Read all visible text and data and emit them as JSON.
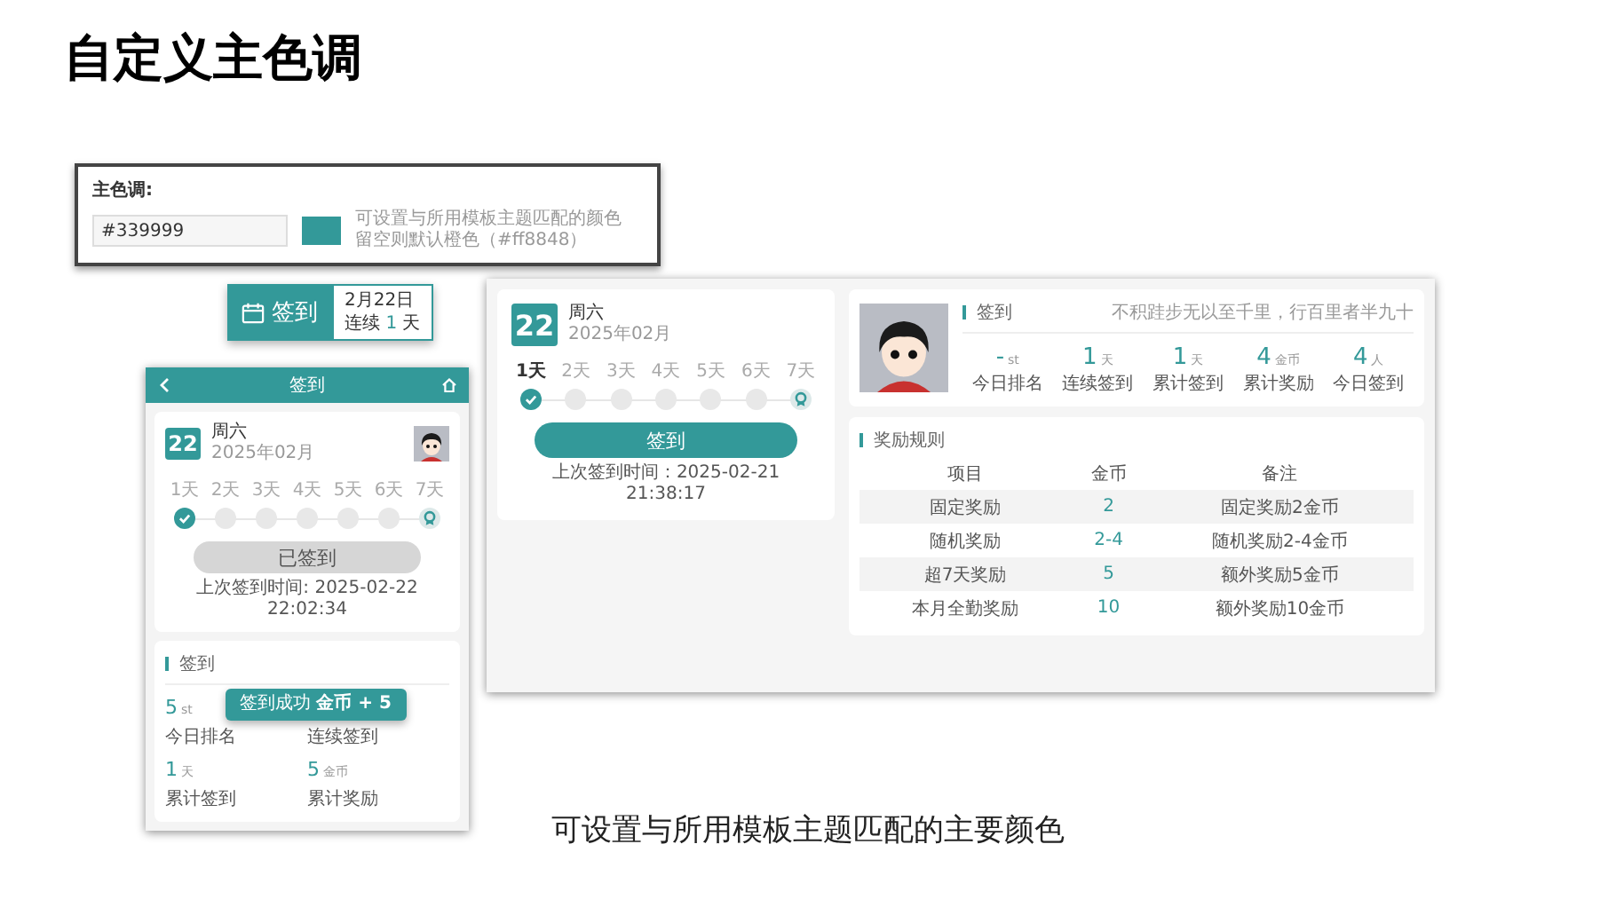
{
  "title": "自定义主色调",
  "color_setting": {
    "label": "主色调:",
    "value": "#339999",
    "hint_lines": [
      "可设置与所用模板主题匹配的颜色",
      "留空则默认橙色（#ff8848）"
    ]
  },
  "sign_button": {
    "label": "签到",
    "date": "2月22日",
    "streak_prefix": "连续",
    "streak_count": "1",
    "streak_suffix": "天"
  },
  "mobile": {
    "header_title": "签到",
    "day": "22",
    "weekday": "周六",
    "month": "2025年02月",
    "days": [
      {
        "label": "1天",
        "kind": "day",
        "signed": true,
        "current": false
      },
      {
        "label": "2天",
        "kind": "day",
        "signed": false,
        "current": false
      },
      {
        "label": "3天",
        "kind": "day",
        "signed": false,
        "current": false
      },
      {
        "label": "4天",
        "kind": "day",
        "signed": false,
        "current": false
      },
      {
        "label": "5天",
        "kind": "day",
        "signed": false,
        "current": false
      },
      {
        "label": "6天",
        "kind": "day",
        "signed": false,
        "current": false
      },
      {
        "label": "7天",
        "kind": "reward",
        "signed": false,
        "current": false
      }
    ],
    "button": {
      "label": "已签到",
      "disabled": true
    },
    "last_sign": "上次签到时间:  2025-02-22 22:02:34",
    "section_title": "签到",
    "toast": "签到成功 **金币 + 5**",
    "stats": [
      {
        "value": "5",
        "unit": "st",
        "label": "今日排名"
      },
      {
        "label": "连续签到"
      },
      {
        "value": "1",
        "unit": "天",
        "label": "累计签到"
      },
      {
        "value": "5",
        "unit": "金币",
        "label": "累计奖励"
      }
    ]
  },
  "desktop": {
    "day": "22",
    "weekday": "周六",
    "month": "2025年02月",
    "days": [
      {
        "label": "1天",
        "kind": "day",
        "signed": true,
        "current": true
      },
      {
        "label": "2天",
        "kind": "day",
        "signed": false,
        "current": false
      },
      {
        "label": "3天",
        "kind": "day",
        "signed": false,
        "current": false
      },
      {
        "label": "4天",
        "kind": "day",
        "signed": false,
        "current": false
      },
      {
        "label": "5天",
        "kind": "day",
        "signed": false,
        "current": false
      },
      {
        "label": "6天",
        "kind": "day",
        "signed": false,
        "current": false
      },
      {
        "label": "7天",
        "kind": "reward",
        "signed": false,
        "current": false
      }
    ],
    "button": {
      "label": "签到",
      "disabled": false
    },
    "last_sign": "上次签到时间：2025-02-21 21:38:17",
    "profile": {
      "section_title": "签到",
      "motto": "不积跬步无以至千里，行百里者半九十",
      "stats": [
        {
          "value": "-",
          "unit": "st",
          "label": "今日排名"
        },
        {
          "value": "1",
          "unit": "天",
          "label": "连续签到"
        },
        {
          "value": "1",
          "unit": "天",
          "label": "累计签到"
        },
        {
          "value": "4",
          "unit": "金币",
          "label": "累计奖励"
        },
        {
          "value": "4",
          "unit": "人",
          "label": "今日签到"
        }
      ]
    },
    "rewards": {
      "title": "奖励规则",
      "columns": [
        "项目",
        "金币",
        "备注"
      ],
      "rows": [
        [
          "固定奖励",
          "2",
          "固定奖励2金币"
        ],
        [
          "随机奖励",
          "2-4",
          "随机奖励2-4金币"
        ],
        [
          "超7天奖励",
          "5",
          "额外奖励5金币"
        ],
        [
          "本月全勤奖励",
          "10",
          "额外奖励10金币"
        ]
      ]
    }
  },
  "caption": "可设置与所用模板主题匹配的主要颜色"
}
